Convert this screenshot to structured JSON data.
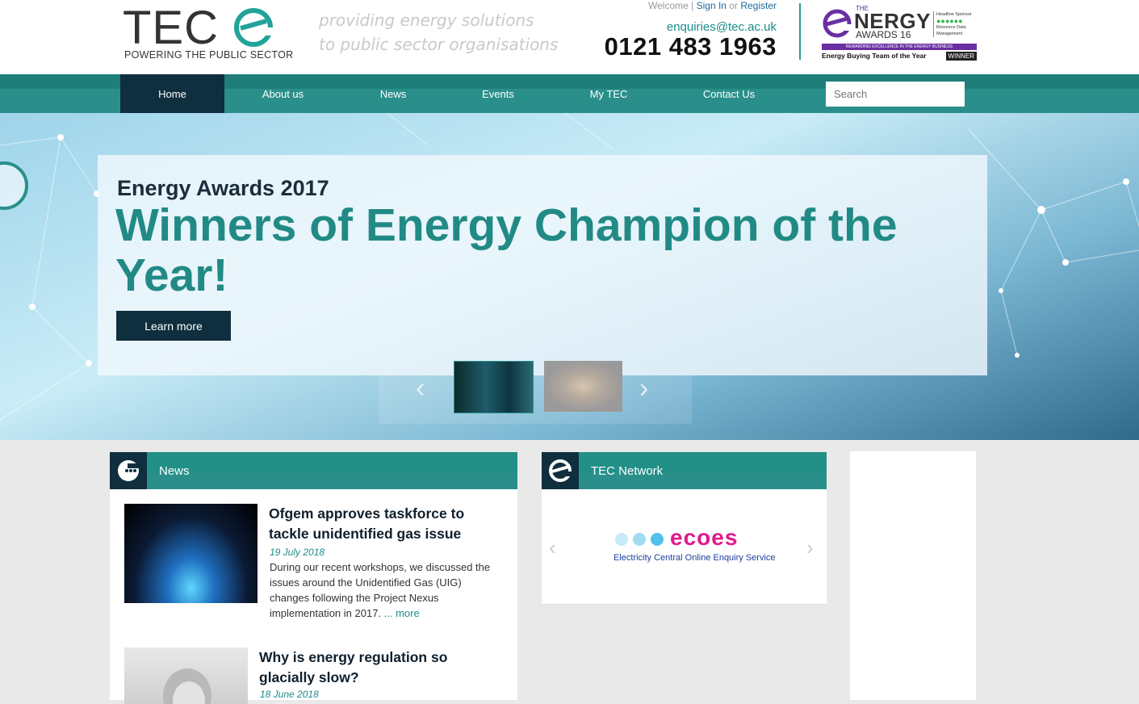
{
  "header": {
    "logo_text": "TEC",
    "logo_tagline": "POWERING THE PUBLIC SECTOR",
    "tagline_line1": "providing energy solutions",
    "tagline_line2": "to public sector organisations",
    "welcome": "Welcome |",
    "sign_in": "Sign In",
    "or": "or",
    "register": "Register",
    "email": "enquiries@tec.ac.uk",
    "phone": "0121 483 1963",
    "award": {
      "the": "THE",
      "energy": "NERGY",
      "awards": "AWARDS 16",
      "sponsor": "Headline Sponsor",
      "sponsor_name": "Resource Data Management",
      "bar": "REWARDING EXCELLENCE IN THE ENERGY BUSINESS",
      "category": "Energy Buying Team of the Year",
      "winner": "WINNER"
    }
  },
  "nav": {
    "items": [
      {
        "label": "Home"
      },
      {
        "label": "About us"
      },
      {
        "label": "News"
      },
      {
        "label": "Events"
      },
      {
        "label": "My TEC"
      },
      {
        "label": "Contact Us"
      }
    ],
    "search_placeholder": "Search"
  },
  "hero": {
    "pretitle": "Energy Awards 2017",
    "title": "Winners of Energy Champion of the Year!",
    "button": "Learn more"
  },
  "news": {
    "heading": "News",
    "items": [
      {
        "title": "Ofgem approves taskforce to tackle unidentified gas issue",
        "date": "19 July 2018",
        "text": "During our recent workshops, we discussed the issues around the Unidentified Gas (UIG) changes following the Project Nexus implementation in 2017.",
        "more": "... more"
      },
      {
        "title": "Why is energy regulation so glacially slow?",
        "date": "18 June 2018"
      }
    ]
  },
  "network": {
    "heading": "TEC Network",
    "logo_word": "ecoes",
    "logo_sub": "Electricity Central Online Enquiry Service"
  },
  "colors": {
    "teal": "#2a8f8b",
    "navy": "#0f2f3f",
    "magenta": "#e0198c"
  }
}
